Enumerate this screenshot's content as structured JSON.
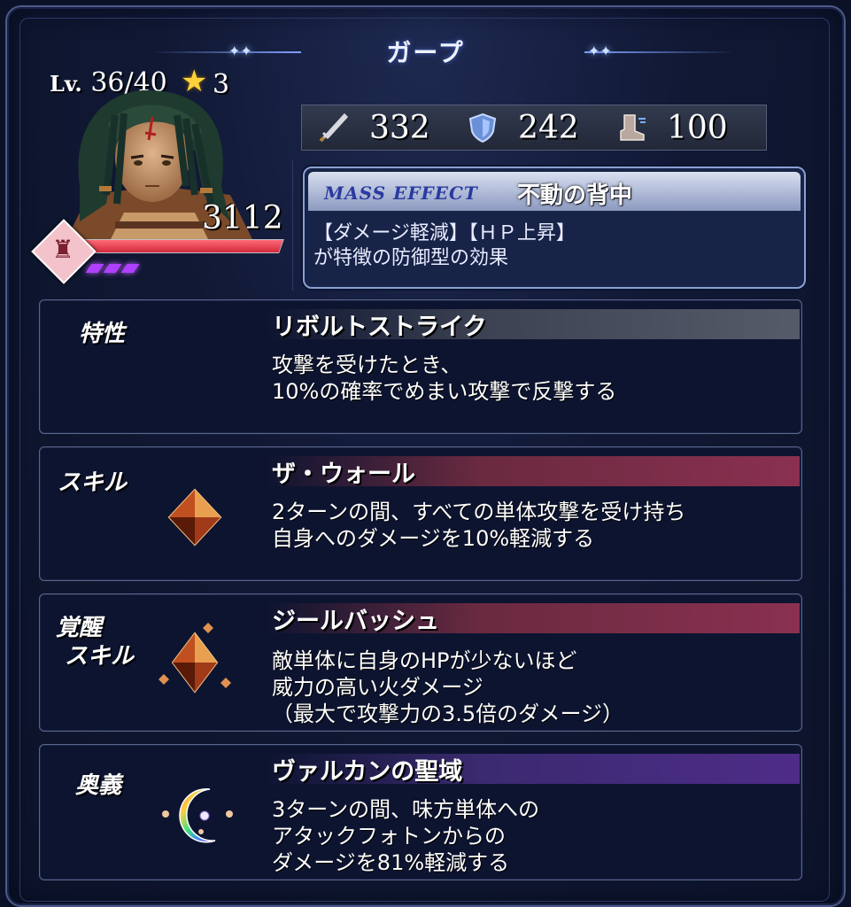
{
  "unit": {
    "name": "ガープ",
    "level_prefix": "Lv.",
    "level": "36/40",
    "stars": "3",
    "hp": "3112",
    "hp_fraction": 1.0,
    "gauge_count": 3
  },
  "stats": {
    "attack": "332",
    "defense": "242",
    "speed": "100",
    "attack_icon": "sword-icon",
    "defense_icon": "shield-icon",
    "speed_icon": "boot-icon"
  },
  "mass_effect": {
    "label": "MASS EFFECT",
    "name": "不動の背中",
    "desc_line1": "【ダメージ軽減】【ＨＰ上昇】",
    "desc_line2": "が特徴の防御型の効果"
  },
  "trait": {
    "category": "特性",
    "name": "リボルトストライク",
    "desc_line1": "攻撃を受けたとき、",
    "desc_line2": "10%の確率でめまい攻撃で反撃する"
  },
  "skill": {
    "category": "スキル",
    "name": "ザ・ウォール",
    "desc_line1": "2ターンの間、すべての単体攻撃を受け持ち",
    "desc_line2": "自身へのダメージを10%軽減する",
    "icon": "fire-crystal-icon"
  },
  "awaken_skill": {
    "category_line1": "覚醒",
    "category_line2": "スキル",
    "name": "ジールバッシュ",
    "desc_line1": "敵単体に自身のHPが少ないほど",
    "desc_line2": "威力の高い火ダメージ",
    "desc_line3": "（最大で攻撃力の3.5倍のダメージ）",
    "icon": "awakened-fire-crystal-icon"
  },
  "ougi": {
    "category": "奥義",
    "name": "ヴァルカンの聖域",
    "desc_line1": "3ターンの間、味方単体への",
    "desc_line2": "アタックフォトンからの",
    "desc_line3": "ダメージを81%軽減する",
    "icon": "rainbow-crescent-icon"
  },
  "colors": {
    "background": "#0b1126",
    "skill_bar": "#8a3050",
    "ougi_bar": "#4e2c88",
    "trait_bar": "#555b68",
    "hp_bar": "#d02a3c",
    "gauge": "#b040ff"
  }
}
